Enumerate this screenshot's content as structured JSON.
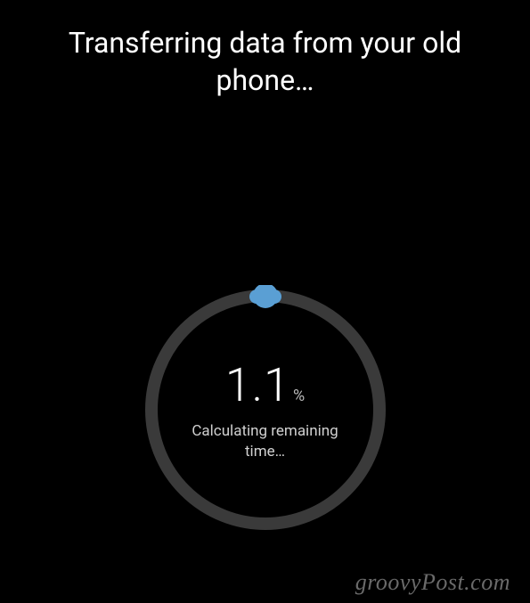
{
  "header": {
    "title": "Transferring data from your old phone…"
  },
  "progress": {
    "value": "1.1",
    "unit": "%",
    "status": "Calculating remaining time…",
    "ring_color": "#3a3a3a",
    "indicator_color": "#5a9fd4",
    "percent_complete": 1.1
  },
  "watermark": {
    "text": "groovyPost.com"
  }
}
